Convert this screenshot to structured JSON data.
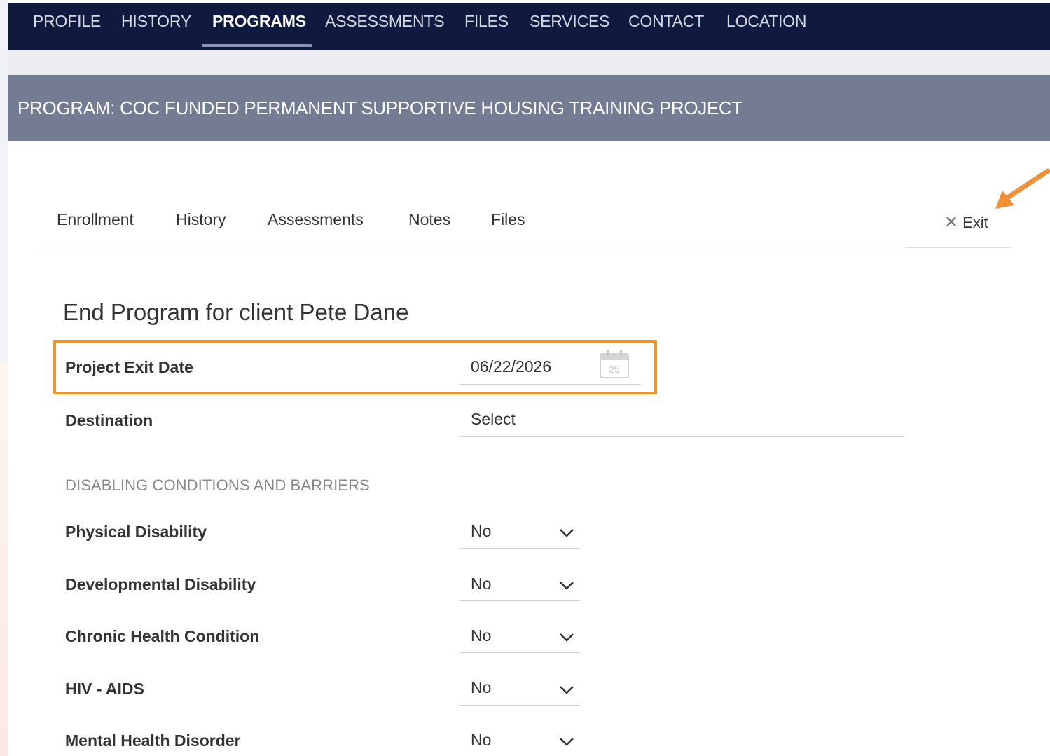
{
  "top_nav": {
    "items": [
      {
        "label": "PROFILE"
      },
      {
        "label": "HISTORY"
      },
      {
        "label": "PROGRAMS",
        "active": true
      },
      {
        "label": "ASSESSMENTS"
      },
      {
        "label": "FILES"
      },
      {
        "label": "SERVICES"
      },
      {
        "label": "CONTACT"
      },
      {
        "label": "LOCATION"
      }
    ]
  },
  "program_header": {
    "title": "PROGRAM: COC FUNDED PERMANENT SUPPORTIVE HOUSING TRAINING PROJECT"
  },
  "sub_tabs": {
    "items": [
      {
        "label": "Enrollment"
      },
      {
        "label": "History"
      },
      {
        "label": "Assessments"
      },
      {
        "label": "Notes"
      },
      {
        "label": "Files"
      }
    ],
    "exit_label": "Exit"
  },
  "form": {
    "title": "End Program for client Pete Dane",
    "exit_date": {
      "label": "Project Exit Date",
      "value": "06/22/2026",
      "calendar_day": "25"
    },
    "destination": {
      "label": "Destination",
      "value": "Select"
    },
    "section_heading": "DISABLING CONDITIONS AND BARRIERS",
    "conditions": [
      {
        "label": "Physical Disability",
        "value": "No"
      },
      {
        "label": "Developmental Disability",
        "value": "No"
      },
      {
        "label": "Chronic Health Condition",
        "value": "No"
      },
      {
        "label": "HIV - AIDS",
        "value": "No"
      },
      {
        "label": "Mental Health Disorder",
        "value": "No"
      }
    ]
  },
  "colors": {
    "nav_bg": "#0f1a3e",
    "program_bar": "#737c93",
    "highlight": "#f7931e",
    "arrow": "#f0913a"
  },
  "icons": {
    "exit": "close-icon",
    "date": "calendar-icon",
    "dropdown": "chevron-down-icon",
    "callout": "arrow-icon"
  }
}
